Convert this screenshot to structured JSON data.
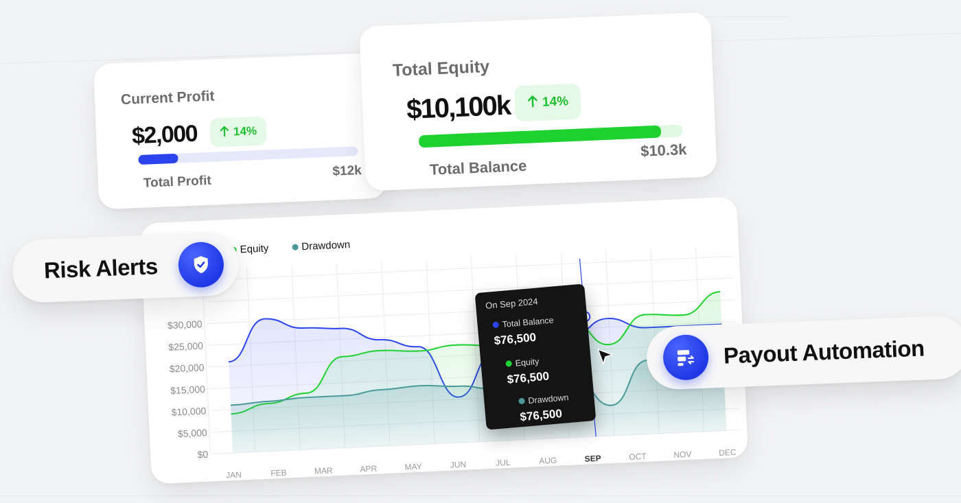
{
  "colors": {
    "accent_blue": "#2b44f0",
    "green": "#1ed12f",
    "teal": "#4a9a9b",
    "badge_bg": "#e5f9e7",
    "badge_text": "#1dbf2f"
  },
  "current_profit": {
    "title": "Current Profit",
    "value": "$2,000",
    "badge": "14%",
    "badge_icon": "arrow-up-icon",
    "progress_fraction": 0.18,
    "label": "Total Profit",
    "max_label": "$12k"
  },
  "total_equity": {
    "title": "Total Equity",
    "value": "$10,100k",
    "badge": "14%",
    "badge_icon": "arrow-up-icon",
    "progress_fraction": 0.92,
    "label": "Total Balance",
    "max_label": "$10.3k"
  },
  "risk_alerts": {
    "label": "Risk Alerts",
    "icon": "shield-check-icon"
  },
  "payout_automation": {
    "label": "Payout Automation",
    "icon": "payout-transfer-icon"
  },
  "tooltip": {
    "title": "On Sep 2024",
    "items": [
      {
        "label": "Total Balance",
        "value": "$76,500",
        "color": "#2b44f0"
      },
      {
        "label": "Equity",
        "value": "$76,500",
        "color": "#1ed12f"
      },
      {
        "label": "Drawdown",
        "value": "$76,500",
        "color": "#4a9a9b"
      }
    ]
  },
  "chart_data": {
    "type": "line",
    "legend": [
      {
        "name": "Equity",
        "color": "#1ed12f"
      },
      {
        "name": "Drawdown",
        "color": "#4a9a9b"
      }
    ],
    "legend_position": "top-left",
    "y_ticks": [
      "$0",
      "$5,000",
      "$10,000",
      "$15,000",
      "$20,000",
      "$25,000",
      "$30,000"
    ],
    "x_ticks": [
      "JAN",
      "FEB",
      "MAR",
      "APR",
      "MAY",
      "JUN",
      "JUL",
      "AUG",
      "SEP",
      "OCT",
      "NOV",
      "DEC"
    ],
    "ylim": [
      0,
      30000
    ],
    "grid": true,
    "highlight_month": "SEP",
    "series": [
      {
        "name": "Total Balance",
        "color": "#2b44f0",
        "values": [
          21000,
          30500,
          28000,
          27500,
          24500,
          22500,
          10500,
          20500,
          20500,
          23000,
          27000,
          24500,
          24500,
          24500
        ]
      },
      {
        "name": "Equity",
        "color": "#1ed12f",
        "values": [
          9000,
          11000,
          13000,
          21000,
          22000,
          21500,
          22500,
          22000,
          23000,
          27500,
          21000,
          27500,
          27000,
          32000
        ]
      },
      {
        "name": "Drawdown",
        "color": "#4a9a9b",
        "values": [
          11000,
          11500,
          12000,
          12000,
          13000,
          13500,
          13000,
          12000,
          6000,
          14500,
          7000,
          17000,
          17000,
          18000
        ]
      }
    ]
  }
}
